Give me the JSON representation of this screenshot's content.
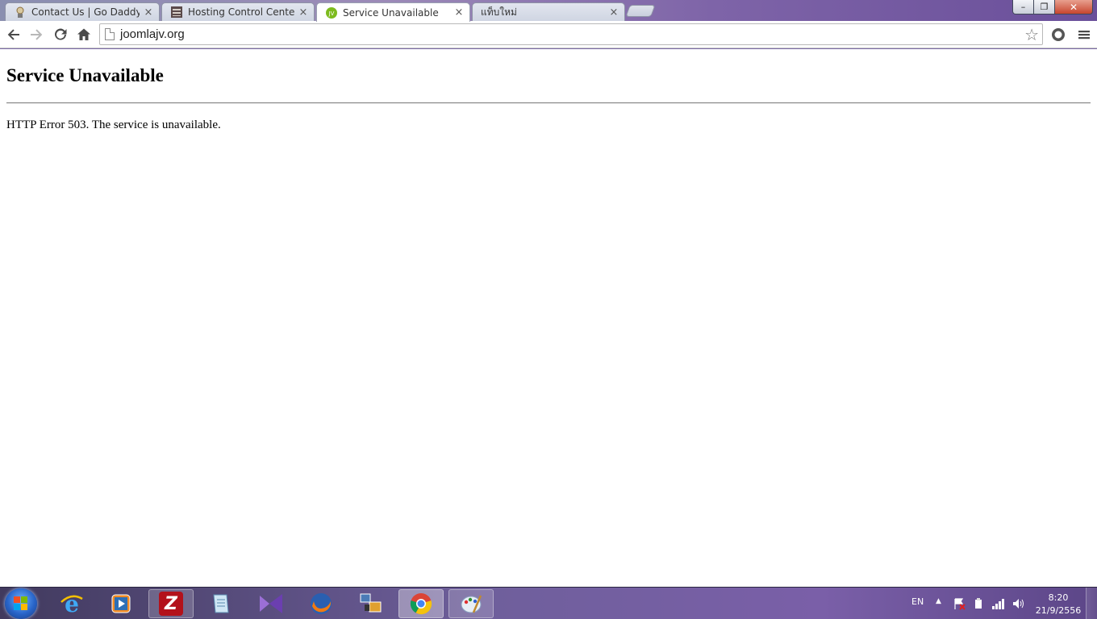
{
  "browser": {
    "tabs": [
      {
        "label": "Contact Us | Go Daddy Su",
        "icon": "go-daddy-favicon"
      },
      {
        "label": "Hosting Control Center",
        "icon": "hosting-favicon"
      },
      {
        "label": "Service Unavailable",
        "icon": "joomlajv-favicon"
      },
      {
        "label": "แท็บใหม่",
        "icon": "blank-favicon"
      }
    ],
    "active_tab": 2,
    "close_glyph": "×",
    "address": "joomlajv.org",
    "window_controls": {
      "minimize": "–",
      "maximize": "❐",
      "close": "✕"
    }
  },
  "page": {
    "heading": "Service Unavailable",
    "message": "HTTP Error 503. The service is unavailable."
  },
  "taskbar": {
    "pinned": [
      "internet-explorer-icon",
      "media-player-icon",
      "filezilla-icon",
      "notepad-icon",
      "visual-studio-icon",
      "firefox-icon",
      "network-tool-icon",
      "chrome-icon",
      "paint-icon"
    ],
    "filezilla_letter": "Z",
    "language": "EN",
    "time": "8:20",
    "date": "21/9/2556"
  }
}
